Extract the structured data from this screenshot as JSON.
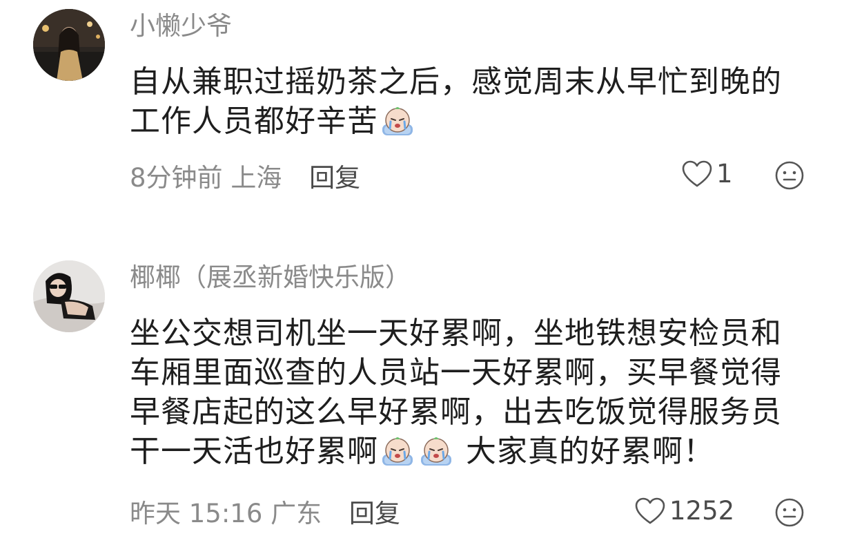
{
  "comments": [
    {
      "username": "小懒少爷",
      "text_line1": "自从兼职过摇奶茶之后，感觉周末从早忙到晚的",
      "text_line2": "工作人员都好辛苦",
      "time": "8分钟前",
      "location": "上海",
      "reply_label": "回复",
      "likes": "1",
      "avatar_icon": "avatar-photo-woman-street"
    },
    {
      "username": "椰椰（展丞新婚快乐版）",
      "text_line1": "坐公交想司机坐一天好累啊，坐地铁想安检员和",
      "text_line2": "车厢里面巡查的人员站一天好累啊，买早餐觉得",
      "text_line3": "早餐店起的这么早好累啊，出去吃饭觉得服务员",
      "text_line4a": "干一天活也好累啊",
      "text_line4b": "大家真的好累啊！",
      "time": "昨天 15:16",
      "location": "广东",
      "reply_label": "回复",
      "likes": "1252",
      "avatar_icon": "avatar-photo-woman-sunglasses"
    }
  ],
  "icons": {
    "like": "heart-outline-icon",
    "dislike": "neutral-face-icon",
    "emoji": "crying-face-emoji"
  }
}
